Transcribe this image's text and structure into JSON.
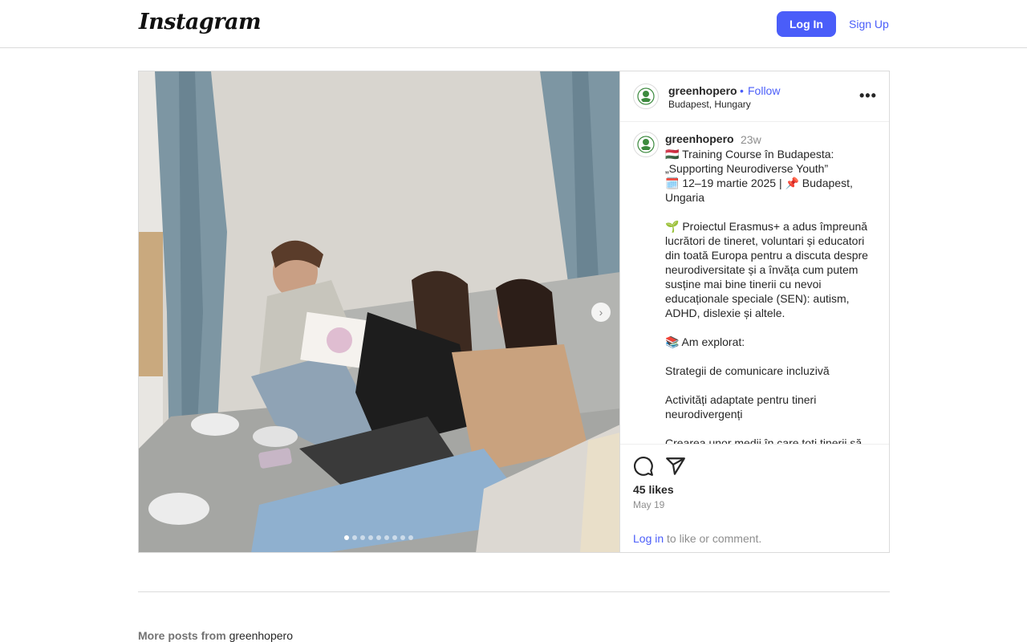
{
  "header": {
    "logo_text": "Instagram",
    "login_label": "Log In",
    "signup_label": "Sign Up"
  },
  "post": {
    "username": "greenhopero",
    "follow_separator": "•",
    "follow_label": "Follow",
    "location": "Budapest, Hungary",
    "more_icon": "more-horizontal-icon",
    "carousel": {
      "count": 9,
      "active_index": 0
    },
    "caption": {
      "username": "greenhopero",
      "time": "23w",
      "text": "🇭🇺 Training Course în Budapesta: „Supporting Neurodiverse Youth”\n🗓️ 12–19 martie 2025 | 📌 Budapest, Ungaria\n\n🌱 Proiectul Erasmus+ a adus împreună lucrători de tineret, voluntari și educatori din toată Europa pentru a discuta despre neurodiversitate și a învăța cum putem susține mai bine tinerii cu nevoi educaționale speciale (SEN): autism, ADHD, dislexie și altele.\n\n📚 Am explorat:\n\nStrategii de comunicare incluzivă\n\nActivități adaptate pentru tineri neurodivergenți\n\nCrearea unor medii în care toți tinerii să"
    },
    "likes": "45 likes",
    "date": "May 19",
    "login_prompt": {
      "link": "Log in",
      "rest": " to like or comment."
    }
  },
  "more_posts": {
    "label": "More posts from",
    "username": "greenhopero"
  },
  "colors": {
    "accent": "#4a5df9",
    "border": "#dbdbdb",
    "muted": "#8e8e8e"
  }
}
